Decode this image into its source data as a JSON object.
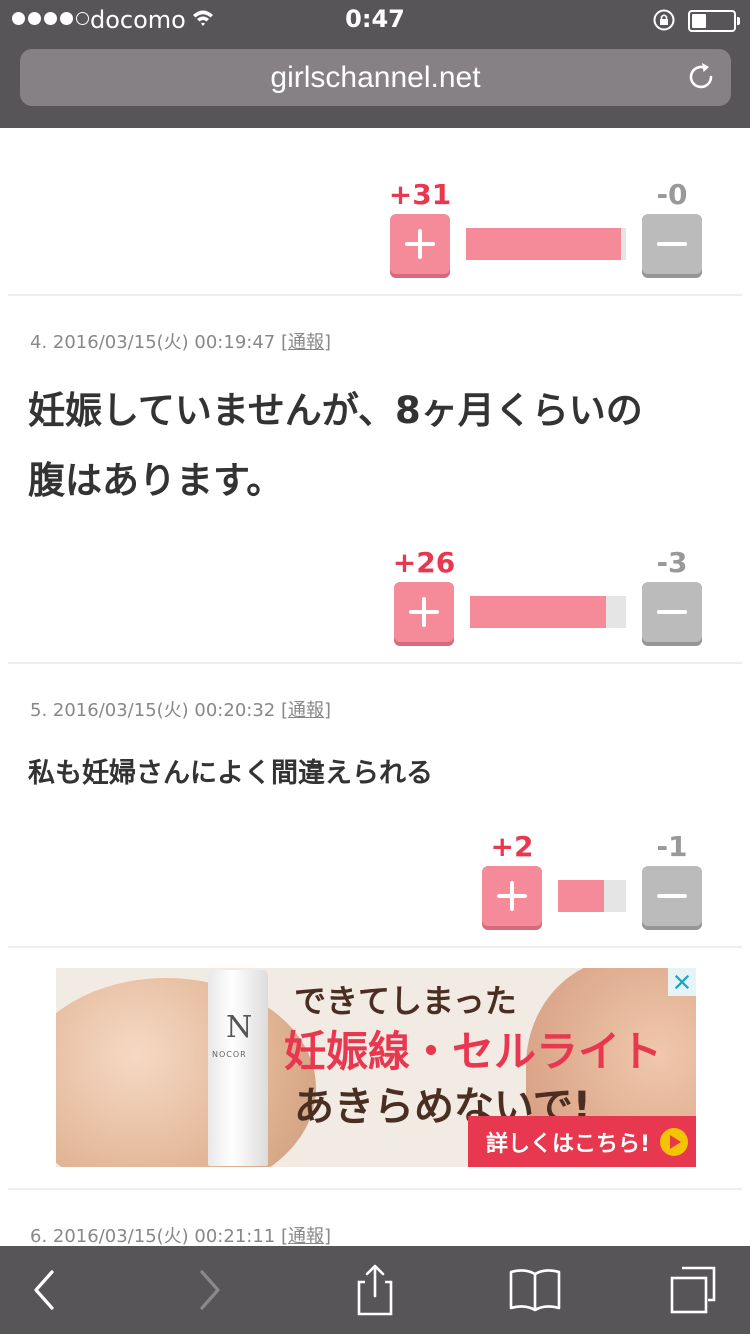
{
  "status_bar": {
    "carrier": "docomo",
    "time": "0:47",
    "signal_bars_filled": 4,
    "signal_bars_total": 5
  },
  "browser": {
    "url": "girlschannel.net"
  },
  "comments": [
    {
      "plus": "+31",
      "minus": "-0",
      "ratio": 0.97
    },
    {
      "meta_prefix": "4.  2016/03/15(火) 00:19:47 ",
      "report": "[通報]",
      "text_line1": "妊娠していませんが、8ヶ月くらいの",
      "text_line2": "腹はあります。",
      "plus": "+26",
      "minus": "-3",
      "ratio": 0.87
    },
    {
      "meta_prefix": "5.  2016/03/15(火) 00:20:32 ",
      "report": "[通報]",
      "text": "私も妊婦さんによく間違えられる",
      "plus": "+2",
      "minus": "-1",
      "ratio": 0.67
    },
    {
      "meta_prefix": "6.  2016/03/15(火) 00:21:11 ",
      "report": "[通報]"
    }
  ],
  "ad": {
    "line1": "できてしまった",
    "line2": "妊娠線・セルライト",
    "line3": "あきらめないで!",
    "cta": "詳しくはこちら!",
    "product_brand": "NOCOR",
    "product_logo": "N"
  },
  "colors": {
    "accent": "#e8384f",
    "plus_button": "#f58a98",
    "minus_button": "#bbbbbb",
    "chrome": "#575557"
  }
}
